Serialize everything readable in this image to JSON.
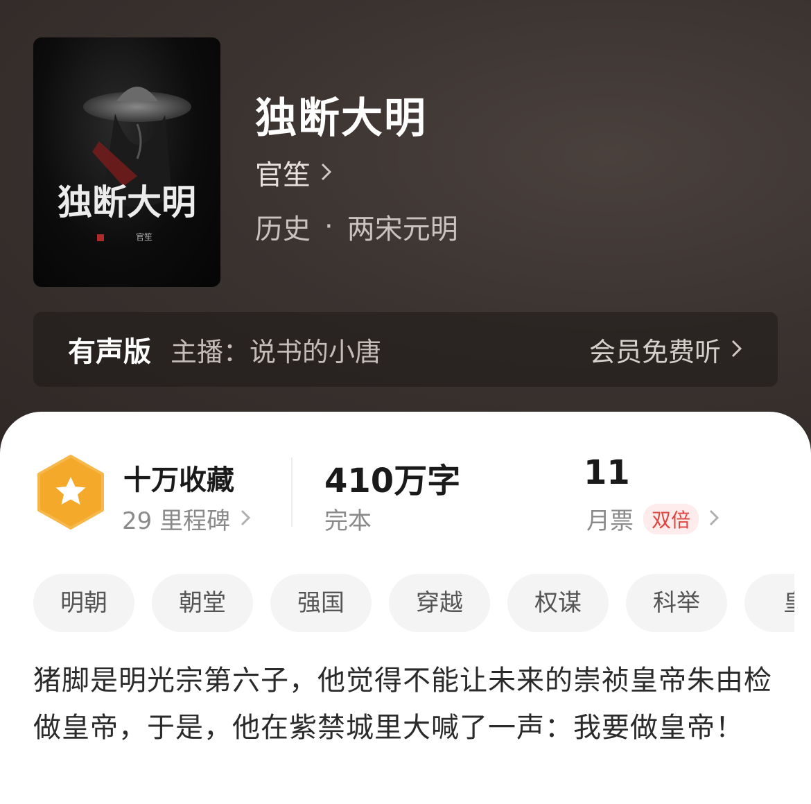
{
  "book": {
    "title": "独断大明",
    "author": "官笙",
    "genre": "历史",
    "subgenre": "两宋元明",
    "separator": "·",
    "cover_title": "独断大明",
    "cover_author": "官笙"
  },
  "audio": {
    "label": "有声版",
    "host": "主播：说书的小唐",
    "cta": "会员免费听"
  },
  "stats": {
    "collection_title": "十万收藏",
    "collection_sub": "29 里程碑",
    "words_title": "410万字",
    "words_sub": "完本",
    "tickets_title": "11",
    "tickets_sub": "月票",
    "tickets_badge": "双倍"
  },
  "tags": [
    "明朝",
    "朝堂",
    "强国",
    "穿越",
    "权谋",
    "科举",
    "皇"
  ],
  "synopsis": "猪脚是明光宗第六子，他觉得不能让未来的崇祯皇帝朱由检做皇帝，于是，他在紫禁城里大喊了一声：我要做皇帝！",
  "colors": {
    "hero_bg": "#3b3330",
    "badge_orange": "#f4a92a",
    "double_badge": "#e0443f"
  },
  "icons": {
    "chevron": "chevron-right-icon",
    "badge": "star-hexagon-icon"
  }
}
